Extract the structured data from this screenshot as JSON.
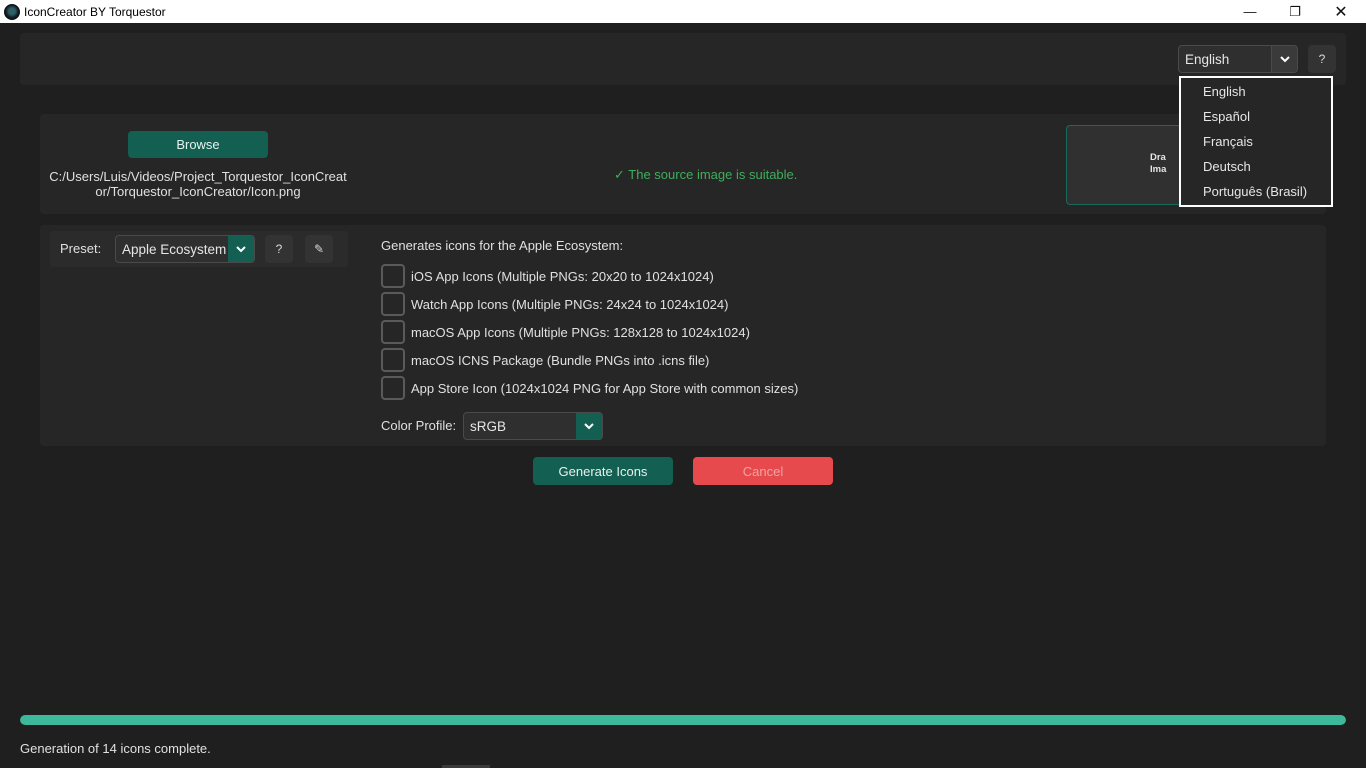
{
  "window": {
    "title": "IconCreator BY Torquestor",
    "minimize_glyph": "—",
    "maximize_glyph": "❐",
    "close_glyph": "✕"
  },
  "header": {
    "language_selected": "English",
    "help_label": "?"
  },
  "language_dropdown": {
    "options": [
      "English",
      "Español",
      "Français",
      "Deutsch",
      "Português (Brasil)"
    ]
  },
  "source": {
    "browse_label": "Browse",
    "path_line1": "C:/Users/Luis/Videos/Project_Torquestor_IconCreat",
    "path_line2": "or/Torquestor_IconCreator/Icon.png",
    "status_check": "✓",
    "status_message": "The source image is suitable.",
    "drop_text_line1": "Dra",
    "drop_text_line2": "Ima"
  },
  "options": {
    "preset_label": "Preset:",
    "preset_value": "Apple Ecosystem",
    "preset_help": "?",
    "preset_edit_glyph": "✎",
    "description": "Generates icons for the Apple Ecosystem:",
    "checkboxes": [
      {
        "label": "iOS App Icons (Multiple PNGs: 20x20 to 1024x1024)",
        "checked": false
      },
      {
        "label": "Watch App Icons (Multiple PNGs: 24x24 to 1024x1024)",
        "checked": false
      },
      {
        "label": "macOS App Icons (Multiple PNGs: 128x128 to 1024x1024)",
        "checked": false
      },
      {
        "label": "macOS ICNS Package (Bundle PNGs into .icns file)",
        "checked": false
      },
      {
        "label": "App Store Icon (1024x1024 PNG for App Store with common sizes)",
        "checked": false
      }
    ],
    "color_profile_label": "Color Profile:",
    "color_profile_value": "sRGB"
  },
  "actions": {
    "generate_label": "Generate Icons",
    "cancel_label": "Cancel"
  },
  "progress": {
    "fraction": 1.0
  },
  "status": {
    "message": "Generation of 14 icons complete."
  },
  "colors": {
    "accent_teal": "#135f51",
    "progress_teal": "#3db89a",
    "cancel_red": "#e74a4c",
    "success_green": "#3fae5b"
  },
  "icons": {
    "chevron": "⌄"
  }
}
